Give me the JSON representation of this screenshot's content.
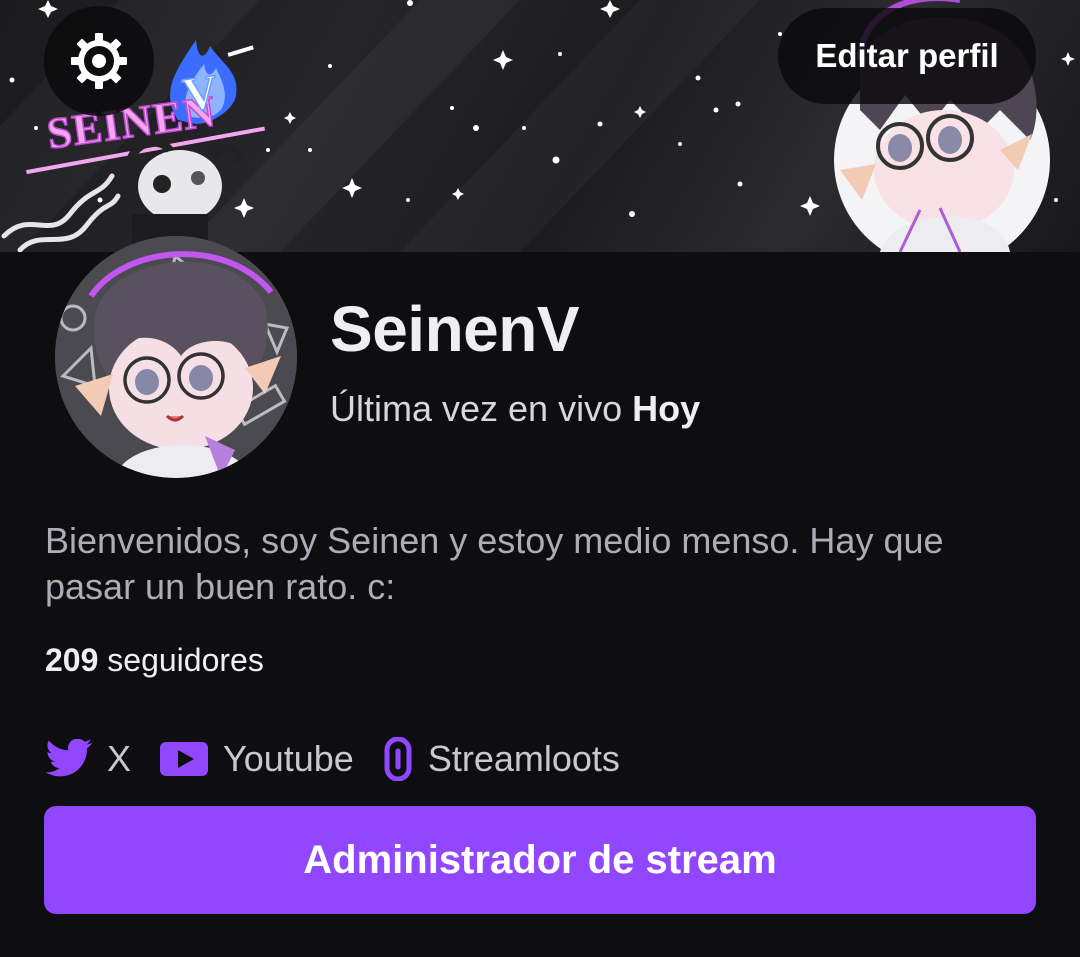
{
  "header": {
    "settings_icon": "gear-icon",
    "edit_profile_label": "Editar perfil",
    "banner_logo_text": "SEINEN"
  },
  "profile": {
    "username": "SeinenV",
    "last_live_prefix": "Última vez en vivo",
    "last_live_value": "Hoy",
    "bio": "Bienvenidos, soy Seinen y estoy medio menso. Hay que pasar un buen rato. c:",
    "followers_count": "209",
    "followers_label": "seguidores"
  },
  "socials": [
    {
      "label": "X",
      "icon": "twitter-bird-icon"
    },
    {
      "label": "Youtube",
      "icon": "youtube-icon"
    },
    {
      "label": "Streamloots",
      "icon": "link-icon"
    }
  ],
  "actions": {
    "stream_manager_label": "Administrador de stream"
  },
  "colors": {
    "accent": "#9147ff",
    "background": "#0e0e10",
    "text_primary": "#efeff1",
    "text_secondary": "#adadb8"
  }
}
